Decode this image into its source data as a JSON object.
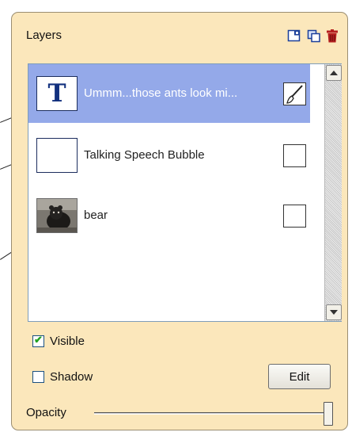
{
  "panel": {
    "title": "Layers",
    "header_icons": [
      "new-layer-icon",
      "duplicate-layer-icon",
      "delete-layer-icon"
    ]
  },
  "layers": [
    {
      "label": "Ummm...those ants look mi...",
      "thumbnail": "text-layer-icon",
      "selected": true,
      "box": "paintbrush-icon"
    },
    {
      "label": "Talking Speech Bubble",
      "thumbnail": "blank",
      "selected": false,
      "box": "empty"
    },
    {
      "label": "bear",
      "thumbnail": "bear-photo",
      "selected": false,
      "box": "empty"
    }
  ],
  "options": {
    "visible": {
      "label": "Visible",
      "checked": true
    },
    "shadow": {
      "label": "Shadow",
      "checked": false
    }
  },
  "edit_label": "Edit",
  "opacity": {
    "label": "Opacity",
    "value": 1.0
  },
  "colors": {
    "panel_bg": "#fbe7bb",
    "selected_row": "#94a9e9",
    "check_green": "#21a121"
  }
}
